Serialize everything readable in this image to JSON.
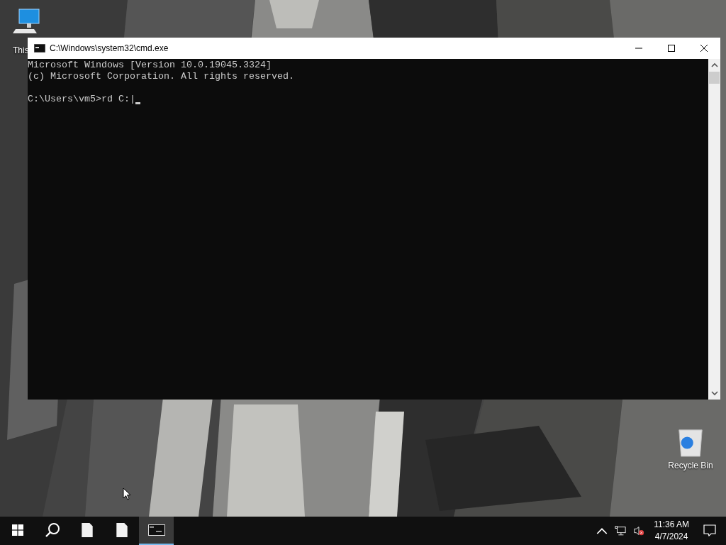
{
  "desktop_icons": [
    {
      "kind": "computer",
      "label": "This"
    },
    {
      "kind": "recycle",
      "label": "Recycle Bin"
    }
  ],
  "window": {
    "title": "C:\\Windows\\system32\\cmd.exe"
  },
  "console": {
    "banner": [
      "Microsoft Windows [Version 10.0.19045.3324]",
      "(c) Microsoft Corporation. All rights reserved."
    ],
    "prompt": "C:\\Users\\vm5>rd C:|"
  },
  "taskbar": {
    "items": [
      {
        "kind": "start",
        "selected": false
      },
      {
        "kind": "search",
        "selected": false
      },
      {
        "kind": "file",
        "selected": false
      },
      {
        "kind": "file",
        "selected": false
      },
      {
        "kind": "console",
        "selected": true
      }
    ],
    "clock": {
      "time": "11:36 AM",
      "date": "4/7/2024"
    }
  }
}
